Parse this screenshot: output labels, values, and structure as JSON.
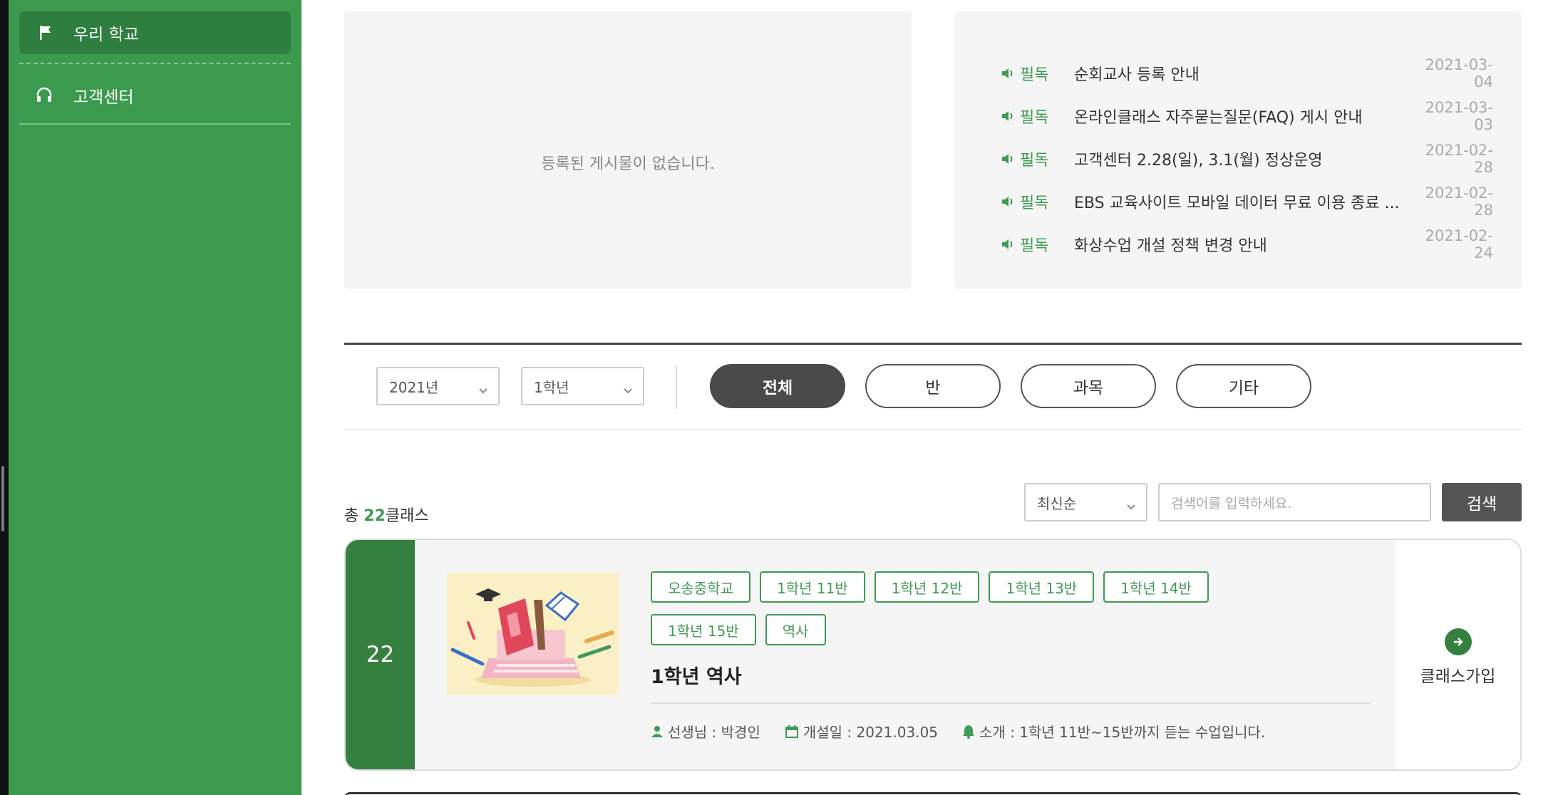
{
  "sidebar": {
    "items": [
      {
        "label": "우리 학교",
        "icon": "flag-icon",
        "active": true
      },
      {
        "label": "고객센터",
        "icon": "headset-icon",
        "active": false
      }
    ]
  },
  "school_board": {
    "empty_message": "등록된 게시물이 없습니다."
  },
  "notices": [
    {
      "badge": "필독",
      "title": "순회교사 등록 안내",
      "date": "2021-03-04"
    },
    {
      "badge": "필독",
      "title": "온라인클래스 자주묻는질문(FAQ) 게시 안내",
      "date": "2021-03-03"
    },
    {
      "badge": "필독",
      "title": "고객센터 2.28(일), 3.1(월) 정상운영",
      "date": "2021-02-28"
    },
    {
      "badge": "필독",
      "title": "EBS 교육사이트 모바일 데이터 무료 이용 종료 ...",
      "date": "2021-02-28"
    },
    {
      "badge": "필독",
      "title": "화상수업 개설 정책 변경 안내",
      "date": "2021-02-24"
    }
  ],
  "filters": {
    "year": "2021년",
    "grade": "1학년",
    "tabs": [
      "전체",
      "반",
      "과목",
      "기타"
    ],
    "active_tab": "전체"
  },
  "list": {
    "total_prefix": "총 ",
    "total_count": "22",
    "total_suffix": "클래스",
    "sort": "최신순",
    "search_placeholder": "검색어를 입력하세요.",
    "search_label": "검색"
  },
  "class_card": {
    "number": "22",
    "tags": [
      "오송중학교",
      "1학년 11반",
      "1학년 12반",
      "1학년 13반",
      "1학년 14반",
      "1학년 15반",
      "역사"
    ],
    "title": "1학년 역사",
    "teacher": "선생님 : 박경인",
    "opened": "개설일 : 2021.03.05",
    "intro": "소개 : 1학년 11반~15반까지 듣는 수업입니다.",
    "join_label": "클래스가입"
  },
  "colors": {
    "sidebar": "#3c9a4e",
    "accent": "#3f9a52",
    "card_number": "#36803f"
  }
}
